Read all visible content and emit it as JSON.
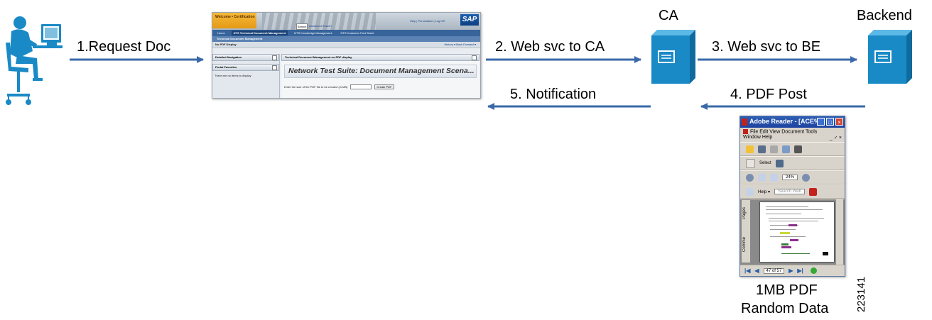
{
  "labels": {
    "step1": "1.Request Doc",
    "step2": "2. Web svc to CA",
    "step3": "3. Web svc to BE",
    "step4": "4. PDF Post",
    "step5": "5. Notification",
    "ca": "CA",
    "backend": "Backend",
    "pdf_line1": "1MB PDF",
    "pdf_line2": "Random Data",
    "figure_id": "223141"
  },
  "portal": {
    "welcome": "Welcome • Certification",
    "search": "Search",
    "advanced_search": "Advanced Search",
    "top_links": "Help | Personalize | Log Off",
    "logo": "SAP",
    "nav_tabs": [
      "Home",
      "NTS Technical Document Management",
      "NTS Knowledge Management",
      "NTS Customer Fact Sheet"
    ],
    "sub_nav": "Technical Document Management",
    "page_label": "No PDF Display",
    "history_links": "History ▾  Back  Forward ▾",
    "left_panel_1": "Detailed Navigation",
    "left_panel_2": "Portal Favorites",
    "left_panel_note": "There are no items to display",
    "right_header": "Technical Document Management no PDF display",
    "banner": "Network Test Suite: Document Management Scena...",
    "form_prompt": "Enter the size of the PDF file to be created (in MB)",
    "create_button": "Create PDF"
  },
  "reader": {
    "title": "Adobe Reader - [ACE%...",
    "menu_line1": "File  Edit  View  Document  Tools",
    "menu_line2": "Window  Help",
    "select_label": "Select",
    "zoom": "24%",
    "help_label": "Help ▾",
    "search_label": "Search Web",
    "tab_pages": "Pages",
    "tab_comments": "Comme",
    "page_indicator": "47 of 57"
  },
  "colors": {
    "arrow": "#3a68a9",
    "server": "#1a8ac6",
    "person": "#1a8ac6"
  }
}
